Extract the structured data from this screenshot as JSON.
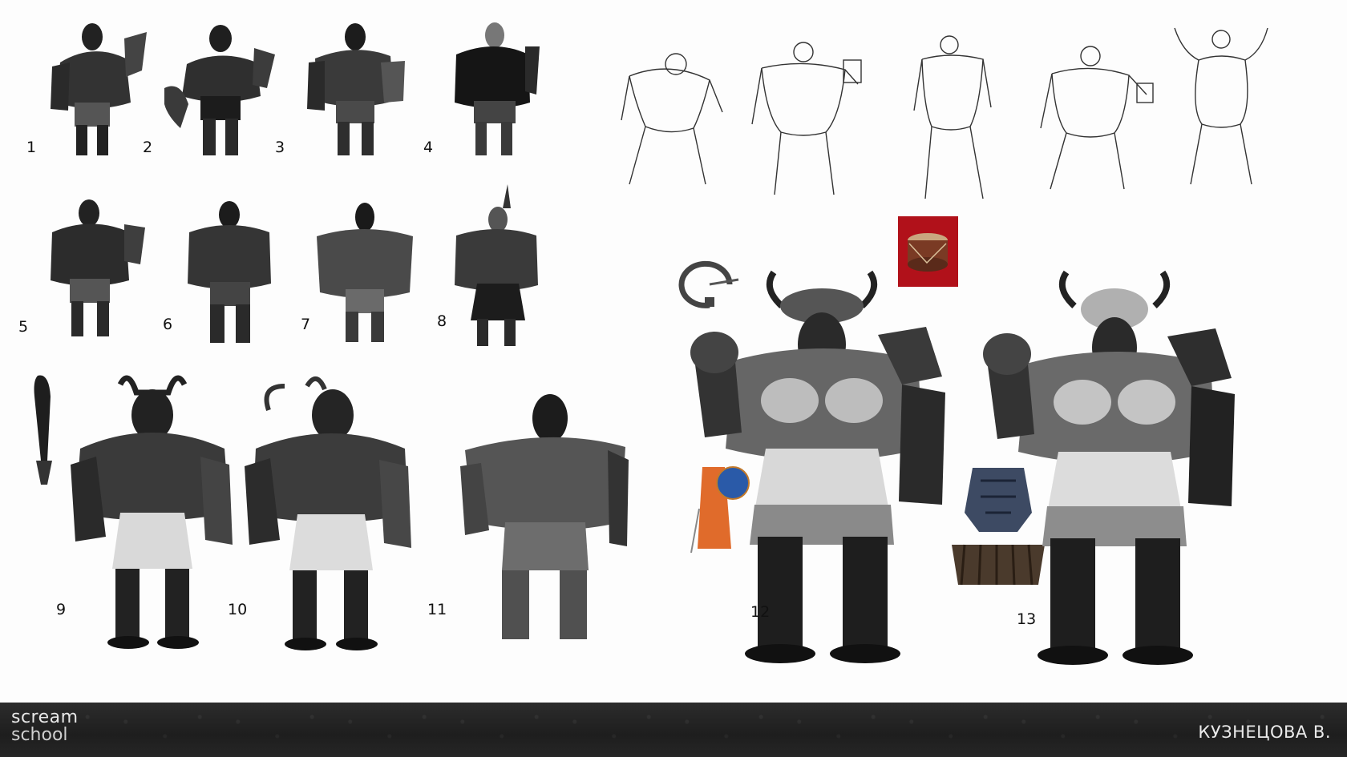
{
  "figures": {
    "labels": [
      "1",
      "2",
      "3",
      "4",
      "5",
      "6",
      "7",
      "8",
      "9",
      "10",
      "11",
      "12",
      "13"
    ]
  },
  "footer": {
    "logo_line1": "scream",
    "logo_line2": "school",
    "author": "КУЗНЕЦОВА В."
  }
}
